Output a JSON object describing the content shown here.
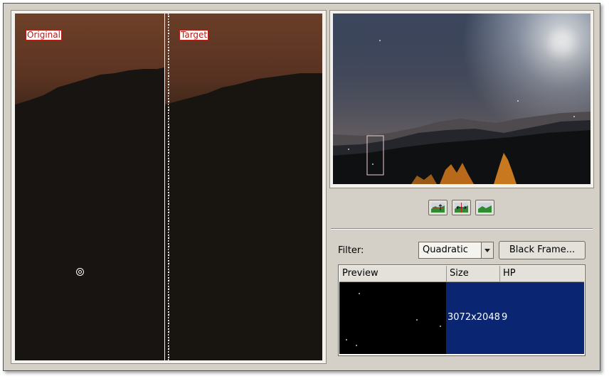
{
  "compare": {
    "left_label": "Original",
    "right_label": "Target"
  },
  "view_modes": [
    {
      "icon": "single-view-icon"
    },
    {
      "icon": "split-view-icon"
    },
    {
      "icon": "image-view-icon"
    }
  ],
  "filter": {
    "label": "Filter:",
    "selected": "Quadratic",
    "button": "Black Frame..."
  },
  "table": {
    "columns": [
      "Preview",
      "Size",
      "HP"
    ],
    "rows": [
      {
        "size": "3072x2048",
        "hp": "9"
      }
    ]
  },
  "colors": {
    "selection": "#0a2672",
    "label_red": "#b81b14",
    "window_bg": "#d4d0c8"
  }
}
